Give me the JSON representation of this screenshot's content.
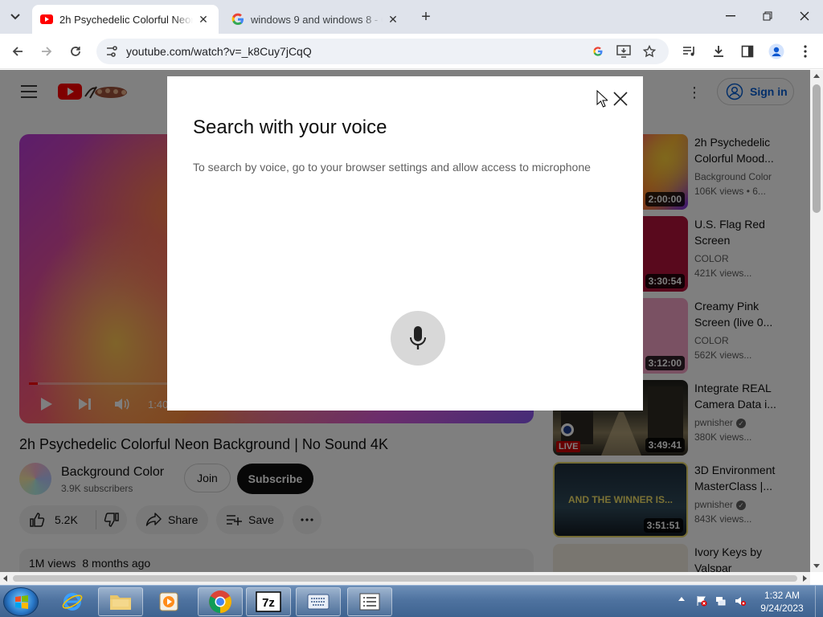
{
  "browser": {
    "tabs": [
      {
        "title": "2h Psychedelic Colorful Neon",
        "active": true
      },
      {
        "title": "windows 9 and windows 8 - Go",
        "active": false
      }
    ],
    "url": "youtube.com/watch?v=_k8Cuy7jCqQ"
  },
  "youtube": {
    "signin_label": "Sign in",
    "player": {
      "time": "1:40",
      "progress_fraction": 0.018
    },
    "video_title": "2h Psychedelic Colorful Neon Background | No Sound 4K",
    "channel": {
      "name": "Background Color",
      "subscribers": "3.9K subscribers"
    },
    "join_label": "Join",
    "subscribe_label": "Subscribe",
    "likes": "5.2K",
    "share_label": "Share",
    "save_label": "Save",
    "description": {
      "views": "1M views",
      "age": "8 months ago"
    },
    "recommendations": [
      {
        "title": "2h Psychedelic Colorful Mood...",
        "channel": "Background Color",
        "views": "106K views",
        "age": "6...",
        "duration": "2:00:00",
        "verified": false,
        "live": false
      },
      {
        "title": "U.S. Flag Red Screen",
        "channel": "COLOR",
        "views": "421K views...",
        "age": "",
        "duration": "3:30:54",
        "verified": false,
        "live": false
      },
      {
        "title": "Creamy Pink Screen (live 0...",
        "channel": "COLOR",
        "views": "562K views...",
        "age": "",
        "duration": "3:12:00",
        "verified": false,
        "live": false
      },
      {
        "title": "Integrate REAL Camera Data i...",
        "channel": "pwnisher",
        "views": "380K views...",
        "age": "",
        "duration": "3:49:41",
        "verified": true,
        "live": true,
        "live_label": "LIVE"
      },
      {
        "title": "3D Environment MasterClass |...",
        "channel": "pwnisher",
        "views": "843K views...",
        "age": "",
        "duration": "3:51:51",
        "verified": true,
        "live": false,
        "overlay_text": "AND THE WINNER IS..."
      },
      {
        "title": "Ivory Keys by Valspar",
        "channel": "",
        "views": "",
        "age": "",
        "duration": "",
        "verified": false,
        "live": false
      }
    ]
  },
  "dialog": {
    "title": "Search with your voice",
    "message": "To search by voice, go to your browser settings and allow access to microphone"
  },
  "taskbar": {
    "time": "1:32 AM",
    "date": "9/24/2023",
    "apps": [
      "internet-explorer",
      "file-explorer",
      "media-player",
      "chrome",
      "7zip",
      "keyboard-app",
      "notepad-app"
    ]
  },
  "colors": {
    "youtube_red": "#ff0000",
    "link_blue": "#065fd4",
    "overlay": "rgba(0,0,0,0.5)"
  }
}
